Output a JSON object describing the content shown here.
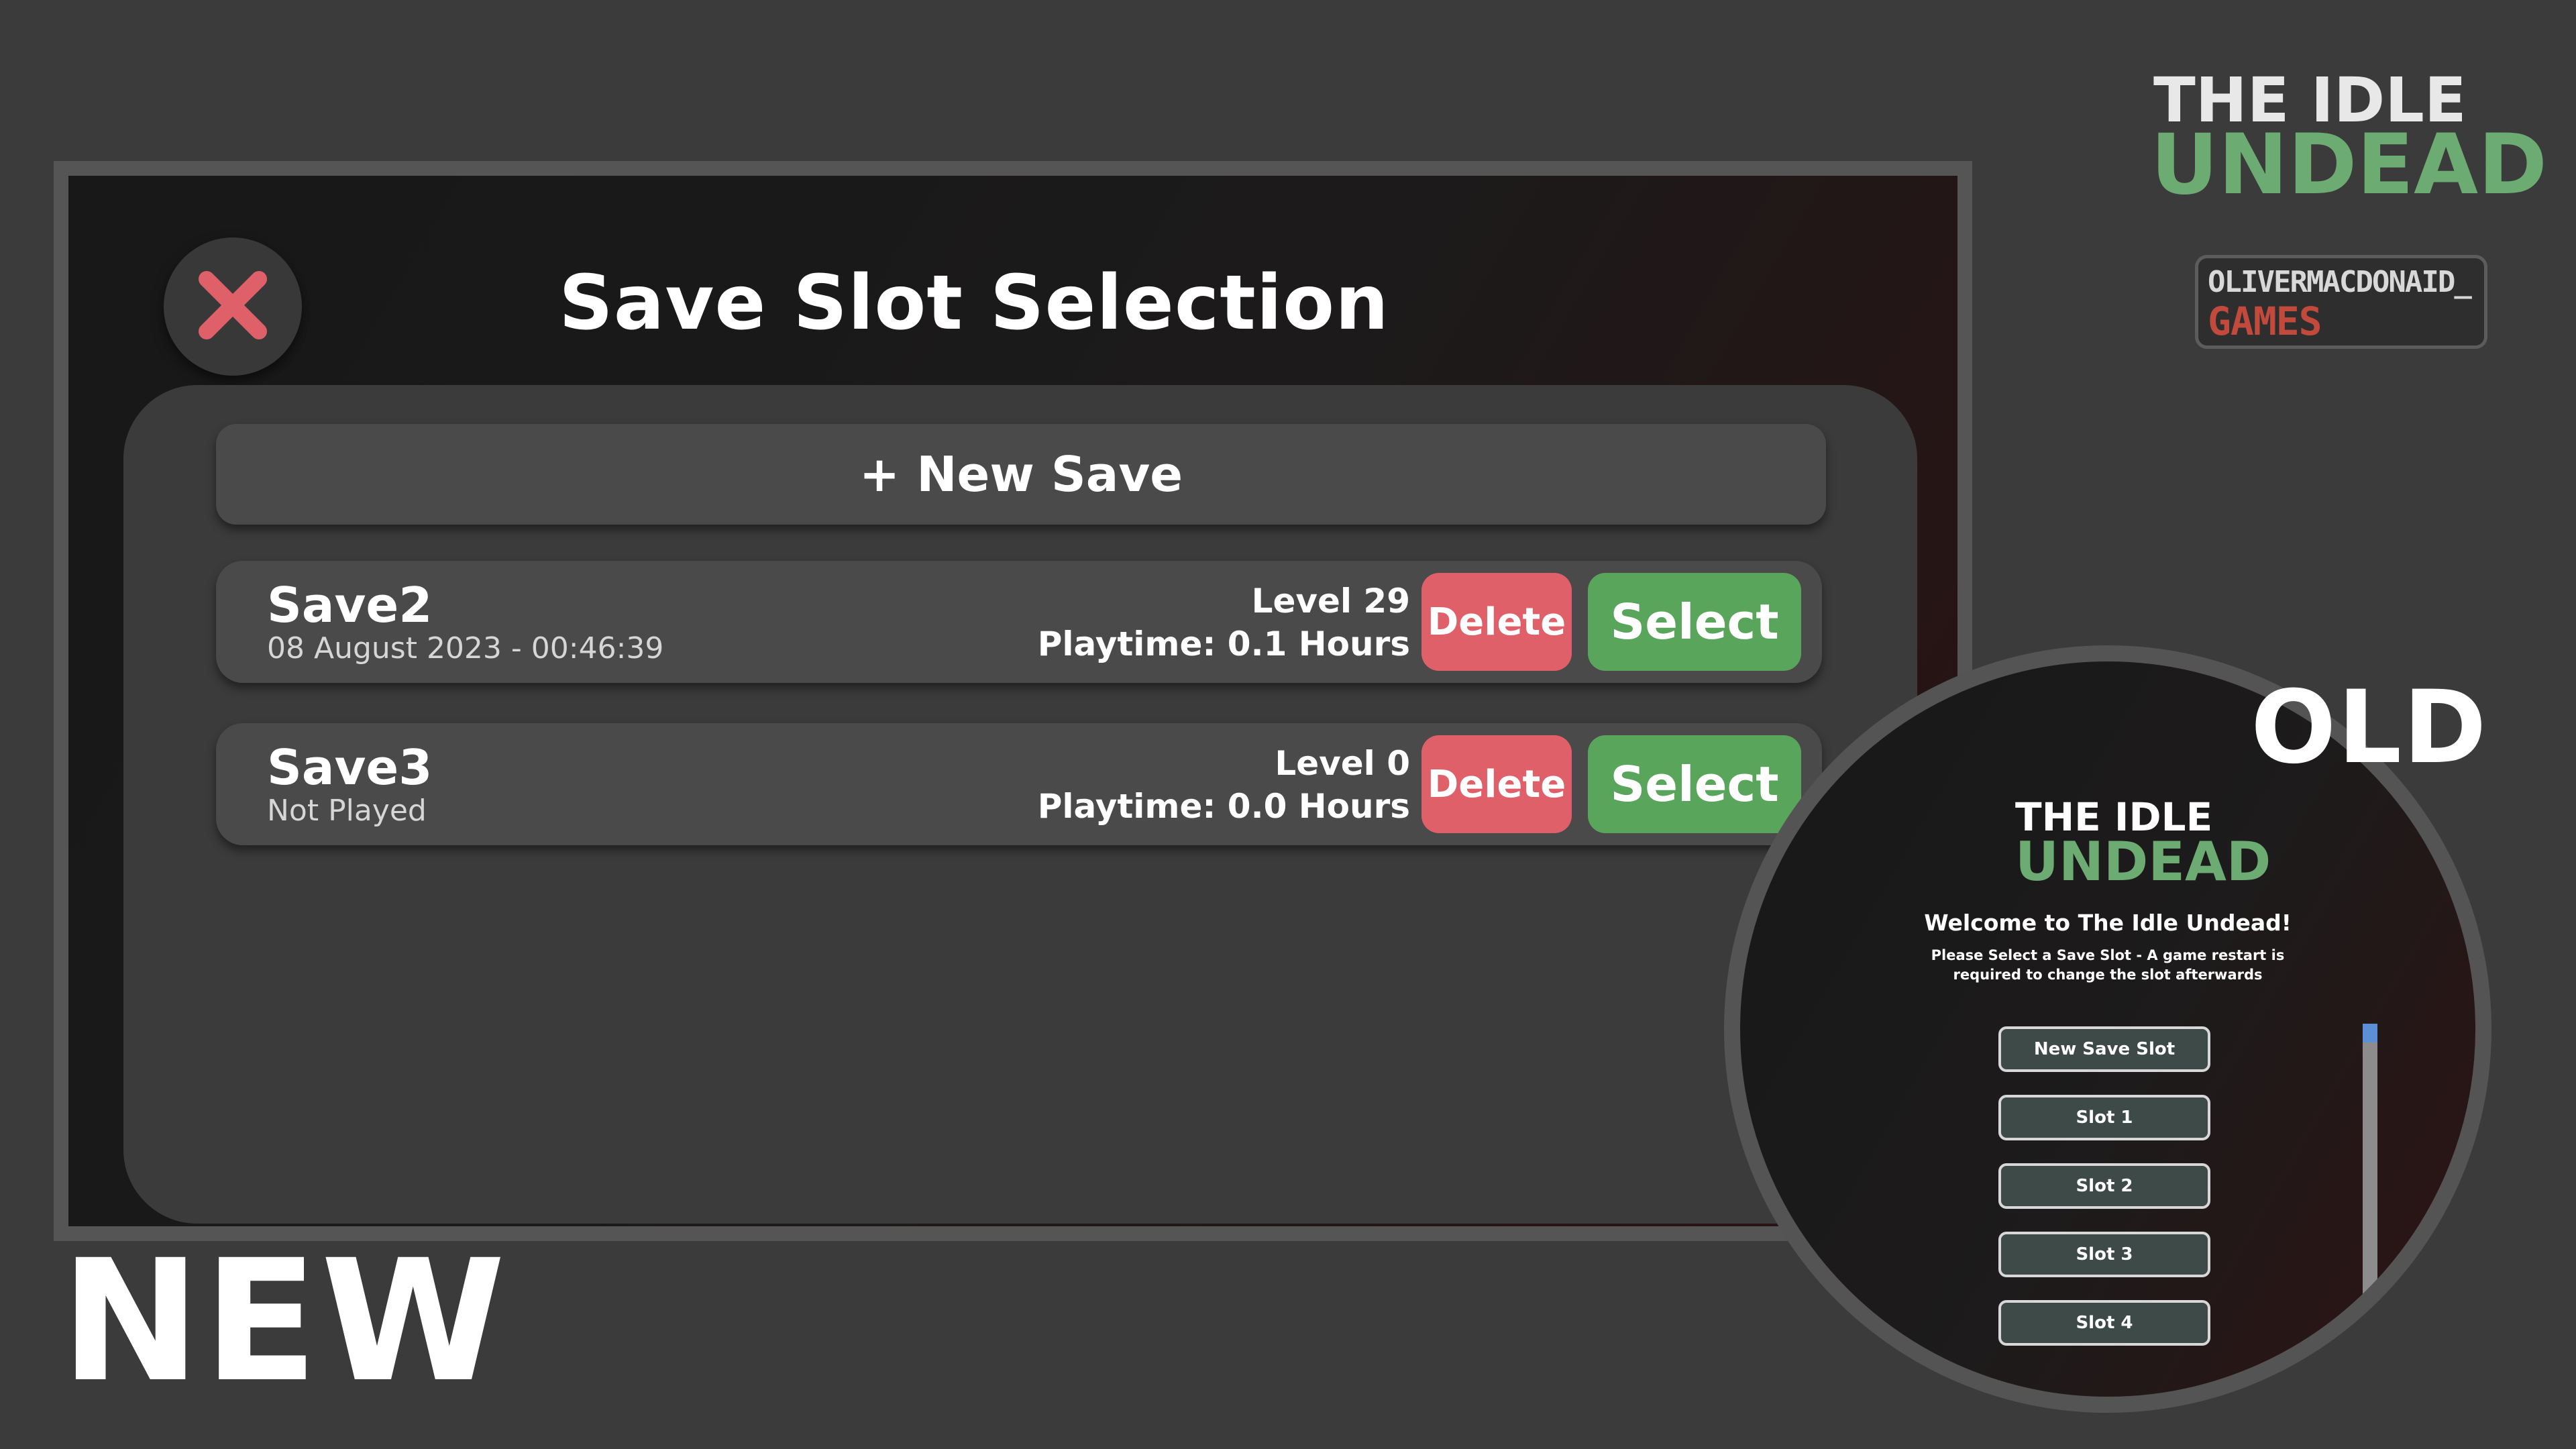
{
  "new_ui": {
    "title": "Save Slot Selection",
    "new_save_label": "+ New Save",
    "slots": [
      {
        "name": "Save2",
        "date": "08 August 2023 - 00:46:39",
        "level": "Level 29",
        "playtime": "Playtime: 0.1 Hours",
        "delete_label": "Delete",
        "select_label": "Select"
      },
      {
        "name": "Save3",
        "date": "Not Played",
        "level": "Level 0",
        "playtime": "Playtime: 0.0 Hours",
        "delete_label": "Delete",
        "select_label": "Select"
      }
    ],
    "label": "NEW"
  },
  "logo": {
    "line1": "THE IDLE",
    "line2": "UNDEAD"
  },
  "studio": {
    "line1": "OLIVERMACDONAID_",
    "line2": "GAMES"
  },
  "old_ui": {
    "label": "OLD",
    "logo_line1": "THE IDLE",
    "logo_line2": "UNDEAD",
    "welcome": "Welcome to The Idle Undead!",
    "instruction": "Please Select a Save Slot - A game restart is required to change the slot afterwards",
    "buttons": [
      "New Save Slot",
      "Slot 1",
      "Slot 2",
      "Slot 3",
      "Slot 4"
    ]
  },
  "colors": {
    "background": "#3b3b3b",
    "delete": "#e0606a",
    "select": "#5aa55c",
    "close_icon": "#e0606a",
    "undead_green": "#6cab72",
    "games_red": "#c24a3c"
  },
  "icons": {
    "close": "close-icon"
  }
}
